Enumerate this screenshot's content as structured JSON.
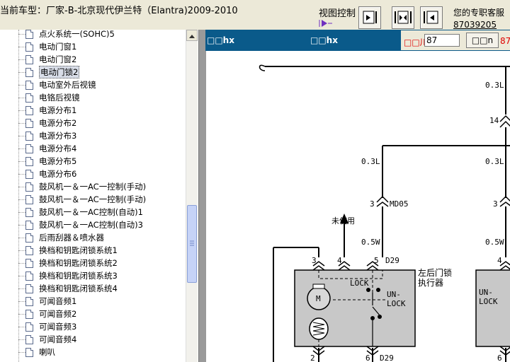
{
  "topbar": {
    "car_title": "当前车型：厂家-B-北京现代伊兰特（Elantra)2009-2010",
    "view_control_label": "视图控制",
    "view_buttons": [
      "fit-page",
      "fit-width",
      "previous-page"
    ],
    "service": {
      "line1": "您的专职客服",
      "line2": "87039205"
    }
  },
  "sidebar": {
    "items": [
      {
        "label": "点火系统一(SOHC)5",
        "selected": false
      },
      {
        "label": "电动门窗1",
        "selected": false
      },
      {
        "label": "电动门窗2",
        "selected": false
      },
      {
        "label": "电动门锁2",
        "selected": true
      },
      {
        "label": "电动室外后视镜",
        "selected": false
      },
      {
        "label": "电铬后视镜",
        "selected": false
      },
      {
        "label": "电源分布1",
        "selected": false
      },
      {
        "label": "电源分布2",
        "selected": false
      },
      {
        "label": "电源分布3",
        "selected": false
      },
      {
        "label": "电源分布4",
        "selected": false
      },
      {
        "label": "电源分布5",
        "selected": false
      },
      {
        "label": "电源分布6",
        "selected": false
      },
      {
        "label": "鼓风机一＆一AC一控制(手动)",
        "selected": false
      },
      {
        "label": "鼓风机一＆一AC一控制(手动)",
        "selected": false
      },
      {
        "label": "鼓风机一＆一AC控制(自动)1",
        "selected": false
      },
      {
        "label": "鼓风机一＆一AC控制(自动)3",
        "selected": false
      },
      {
        "label": "后雨刮器＆喷水器",
        "selected": false
      },
      {
        "label": "换档和钥匙闭锁系统1",
        "selected": false
      },
      {
        "label": "换档和钥匙闭锁系统2",
        "selected": false
      },
      {
        "label": "换档和钥匙闭锁系统3",
        "selected": false
      },
      {
        "label": "换档和钥匙闭锁系统4",
        "selected": false
      },
      {
        "label": "可闻音频1",
        "selected": false
      },
      {
        "label": "可闻音频2",
        "selected": false
      },
      {
        "label": "可闻音频3",
        "selected": false
      },
      {
        "label": "可闻音频4",
        "selected": false
      },
      {
        "label": "喇叭",
        "selected": false
      }
    ]
  },
  "content": {
    "header_left": "□□hx",
    "header_mid": "□□hx",
    "page_label": "□□川",
    "page_value": "87",
    "go_button": "□□n",
    "page_total": "87"
  },
  "diagram": {
    "wire_top_right": "0.3L",
    "pin_14": "14",
    "wire_left_mid": "0.3L",
    "wire_right_mid": "0.3L",
    "conn_left_pin": "3",
    "conn_left_name": "MD05",
    "conn_right_pin": "3",
    "unused_label": "未使用",
    "wire_left_low": "0.5W",
    "wire_right_low": "0.5W",
    "pin_3": "3",
    "pin_4": "4",
    "pin_5": "5",
    "conn_d29_top": "D29",
    "pin_4_right": "4",
    "actuator_title_1": "左后门锁",
    "actuator_title_2": "执行器",
    "lock_label": "LOCK",
    "unlock_label_1": "UN-",
    "unlock_label_2": "LOCK",
    "motor_label": "M",
    "right_unlock_1": "UN-",
    "right_unlock_2": "LOCK",
    "pin_2": "2",
    "pin_6": "6",
    "conn_d29_bottom": "D29",
    "pin_6_right": "6"
  }
}
